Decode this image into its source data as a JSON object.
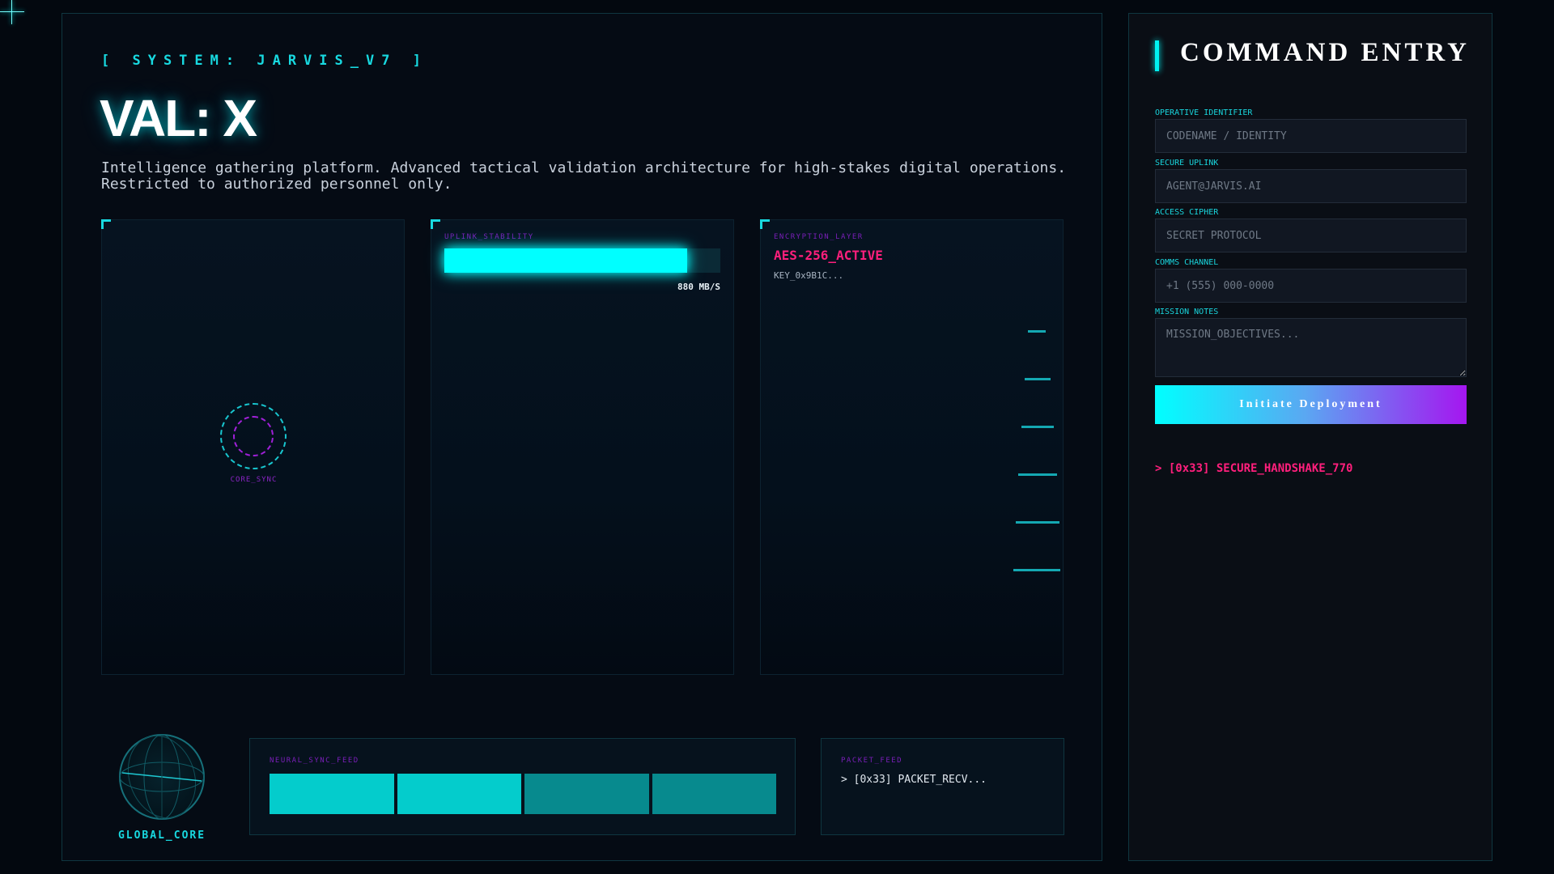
{
  "system": {
    "tag": "[ SYSTEM: JARVIS_V7 ]"
  },
  "hero": {
    "title": "VAL: X",
    "description": "Intelligence gathering platform. Advanced tactical validation architecture for high-stakes digital operations. Restricted to authorized personnel only."
  },
  "cards": {
    "core_sync": {
      "label": "CORE_SYNC"
    },
    "uplink": {
      "label": "UPLINK_STABILITY",
      "level": 0.88,
      "rate": "880 MB/S"
    },
    "encryption": {
      "label": "ENCRYPTION_LAYER",
      "status": "AES-256_ACTIVE",
      "key": "KEY_0x9B1C..."
    }
  },
  "bottom": {
    "globe_label": "GLOBAL_CORE",
    "neural_feed": {
      "label": "NEURAL_SYNC_FEED",
      "bars": [
        "#04cccc",
        "#04cccc",
        "#078a8e",
        "#078a8e"
      ]
    },
    "packet_feed": {
      "label": "PACKET_FEED",
      "line": "> [0x33] PACKET_RECV..."
    }
  },
  "command": {
    "title": "COMMAND ENTRY",
    "fields": {
      "operative": {
        "label": "OPERATIVE IDENTIFIER",
        "placeholder": "CODENAME / IDENTITY",
        "value": ""
      },
      "uplink": {
        "label": "SECURE UPLINK",
        "placeholder": "AGENT@JARVIS.AI",
        "value": ""
      },
      "cipher": {
        "label": "ACCESS CIPHER",
        "placeholder": "SECRET PROTOCOL",
        "value": ""
      },
      "comms": {
        "label": "COMMS CHANNEL",
        "placeholder": "+1 (555) 000-0000",
        "value": ""
      },
      "notes": {
        "label": "MISSION NOTES",
        "placeholder": "MISSION_OBJECTIVES...",
        "value": ""
      }
    },
    "deploy_label": "Initiate Deployment",
    "handshake": "> [0x33] SECURE_HANDSHAKE_770"
  },
  "colors": {
    "accent_cyan": "#00ffff",
    "accent_magenta": "#ff1f7c",
    "accent_purple": "#a516f0",
    "background": "#03080f"
  }
}
